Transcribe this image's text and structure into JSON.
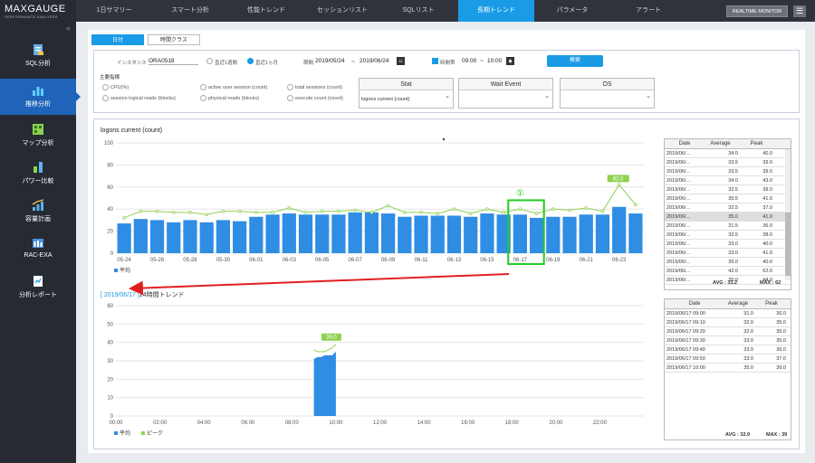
{
  "logo": {
    "title": "MAXGAUGE",
    "subtitle": "PERFORMANCE ANALYZER"
  },
  "sidebar": {
    "collapse": "«",
    "items": [
      {
        "label": "SQL分析",
        "icon": "sql-icon"
      },
      {
        "label": "推移分析",
        "icon": "bar-chart-icon"
      },
      {
        "label": "マップ分析",
        "icon": "map-icon"
      },
      {
        "label": "パワー比較",
        "icon": "power-compare-icon"
      },
      {
        "label": "容量計画",
        "icon": "capacity-icon"
      },
      {
        "label": "RAC-EXA",
        "icon": "rac-icon"
      },
      {
        "label": "分析レポート",
        "icon": "report-icon"
      }
    ]
  },
  "topnav": {
    "tabs": [
      "1日サマリー",
      "スマート分析",
      "性能トレンド",
      "セッションリスト",
      "SQLリスト",
      "長期トレンド",
      "パラメータ",
      "アラート"
    ],
    "active": 5,
    "realtime": "REALTIME MONITOR",
    "menu": "☰"
  },
  "subtabs": [
    "日付",
    "時間クラス"
  ],
  "filter": {
    "instance_label": "インスタンス",
    "instance_value": "ORA0518",
    "range1": "直近1週間",
    "range2": "直近1ヵ月",
    "period_label": "期間",
    "date_from": "2019/05/24",
    "sep": "~",
    "date_to": "2019/06/24",
    "time_label": "時間帯",
    "time_from": "09:00",
    "time_sep": "~",
    "time_to": "10:00",
    "search": "検索",
    "metric_label": "主要指標",
    "metrics": [
      "CPU(%)",
      "active user session (count)",
      "total sessions (count)",
      "session logical reads (blocks)",
      "physical reads (blocks)",
      "execute count (count)"
    ],
    "stat": {
      "header": "Stat",
      "value": "logons current (count)"
    },
    "wait": {
      "header": "Wait Event",
      "value": ""
    },
    "os": {
      "header": "OS",
      "value": ""
    }
  },
  "chart_data": [
    {
      "type": "bar",
      "title": "logons current (count)",
      "ylim": [
        0,
        100
      ],
      "yticks": [
        0,
        20,
        40,
        60,
        80,
        100
      ],
      "categories": [
        "05-24",
        "05-25",
        "05-26",
        "05-27",
        "05-28",
        "05-29",
        "05-30",
        "05-31",
        "06-01",
        "06-02",
        "06-03",
        "06-04",
        "06-05",
        "06-06",
        "06-07",
        "06-08",
        "06-09",
        "06-10",
        "06-11",
        "06-12",
        "06-13",
        "06-14",
        "06-15",
        "06-16",
        "06-17",
        "06-18",
        "06-19",
        "06-20",
        "06-21",
        "06-22",
        "06-23",
        "06-24"
      ],
      "series": [
        {
          "name": "平均",
          "values": [
            27,
            31,
            30,
            28,
            30,
            28,
            30,
            29,
            33,
            35,
            36,
            35,
            35,
            35,
            37,
            37,
            36,
            33,
            34,
            34,
            34,
            33,
            36,
            35,
            35,
            32,
            33,
            33,
            35,
            35,
            42,
            36
          ]
        },
        {
          "name": "ピーク",
          "values": [
            32,
            38,
            38,
            37,
            37,
            35,
            38,
            38,
            37,
            37,
            41,
            37,
            38,
            38,
            39,
            37,
            43,
            37,
            37,
            36,
            40,
            36,
            40,
            37,
            40,
            36,
            40,
            39,
            41,
            38,
            62,
            44
          ]
        }
      ],
      "xlabels": [
        "05-24",
        "05-26",
        "05-28",
        "05-30",
        "06-01",
        "06-03",
        "06-05",
        "06-07",
        "06-09",
        "06-11",
        "06-13",
        "06-15",
        "06-17",
        "06-19",
        "06-21",
        "06-23"
      ],
      "peak_label": "62.0",
      "highlight": "06-17",
      "annotation": "①"
    },
    {
      "type": "bar",
      "title": "24時間トレンド",
      "ylim": [
        0,
        60
      ],
      "yticks": [
        0,
        10,
        20,
        30,
        40,
        50,
        60
      ],
      "xlabels": [
        "00:00",
        "02:00",
        "04:00",
        "06:00",
        "08:00",
        "10:00",
        "12:00",
        "14:00",
        "16:00",
        "18:00",
        "20:00",
        "22:00"
      ],
      "x": [
        "09:00",
        "09:10",
        "09:20",
        "09:30",
        "09:40",
        "09:50",
        "10:00"
      ],
      "series": [
        {
          "name": "平均",
          "values": [
            31,
            32,
            32,
            33,
            33,
            33,
            35
          ]
        },
        {
          "name": "ピーク",
          "values": [
            36,
            35,
            35,
            35,
            36,
            37,
            39
          ]
        }
      ],
      "peak_label": "39.0"
    }
  ],
  "legend": {
    "avg": "平均",
    "peak": "ピーク"
  },
  "trend_date": "2019/06/17",
  "trend_bracket_open": "[ ",
  "trend_bracket_close": " ]",
  "trend_title": "24時間トレンド",
  "table1": {
    "headers": [
      "Date",
      "Average",
      "Peak"
    ],
    "rows": [
      [
        "2019/06/…",
        "34.0",
        "40.0"
      ],
      [
        "2019/06/…",
        "33.5",
        "39.0"
      ],
      [
        "2019/06/…",
        "33.5",
        "39.0"
      ],
      [
        "2019/06/…",
        "34.0",
        "43.0"
      ],
      [
        "2019/06/…",
        "32.5",
        "39.0"
      ],
      [
        "2019/06/…",
        "35.5",
        "41.0"
      ],
      [
        "2019/06/…",
        "32.5",
        "37.0"
      ],
      [
        "2019/06/…",
        "35.0",
        "41.0"
      ],
      [
        "2019/06/…",
        "31.5",
        "36.0"
      ],
      [
        "2019/06/…",
        "32.5",
        "38.0"
      ],
      [
        "2019/06/…",
        "33.0",
        "40.0"
      ],
      [
        "2019/06/…",
        "33.0",
        "41.0"
      ],
      [
        "2019/06/…",
        "35.0",
        "40.0"
      ],
      [
        "2019/06/…",
        "42.0",
        "62.0"
      ],
      [
        "2019/06/…",
        "35.0",
        "44.0"
      ]
    ],
    "selected": 7,
    "avg_label": "AVG : 33.2",
    "max_label": "MAX : 62"
  },
  "table2": {
    "headers": [
      "Date",
      "Average",
      "Peak"
    ],
    "rows": [
      [
        "2019/06/17 09:00",
        "31.0",
        "36.0"
      ],
      [
        "2019/06/17 09:10",
        "32.0",
        "35.0"
      ],
      [
        "2019/06/17 09:20",
        "32.0",
        "35.0"
      ],
      [
        "2019/06/17 09:30",
        "33.0",
        "35.0"
      ],
      [
        "2019/06/17 09:40",
        "33.0",
        "36.0"
      ],
      [
        "2019/06/17 09:50",
        "33.0",
        "37.0"
      ],
      [
        "2019/06/17 10:00",
        "35.0",
        "39.0"
      ]
    ],
    "avg_label": "AVG : 32.9",
    "max_label": "MAX : 39"
  },
  "colors": {
    "accent": "#1a9be5",
    "bar": "#2f8de4",
    "peak": "#8fd14f",
    "highlight": "#22cc22",
    "arrow": "#e02020"
  }
}
